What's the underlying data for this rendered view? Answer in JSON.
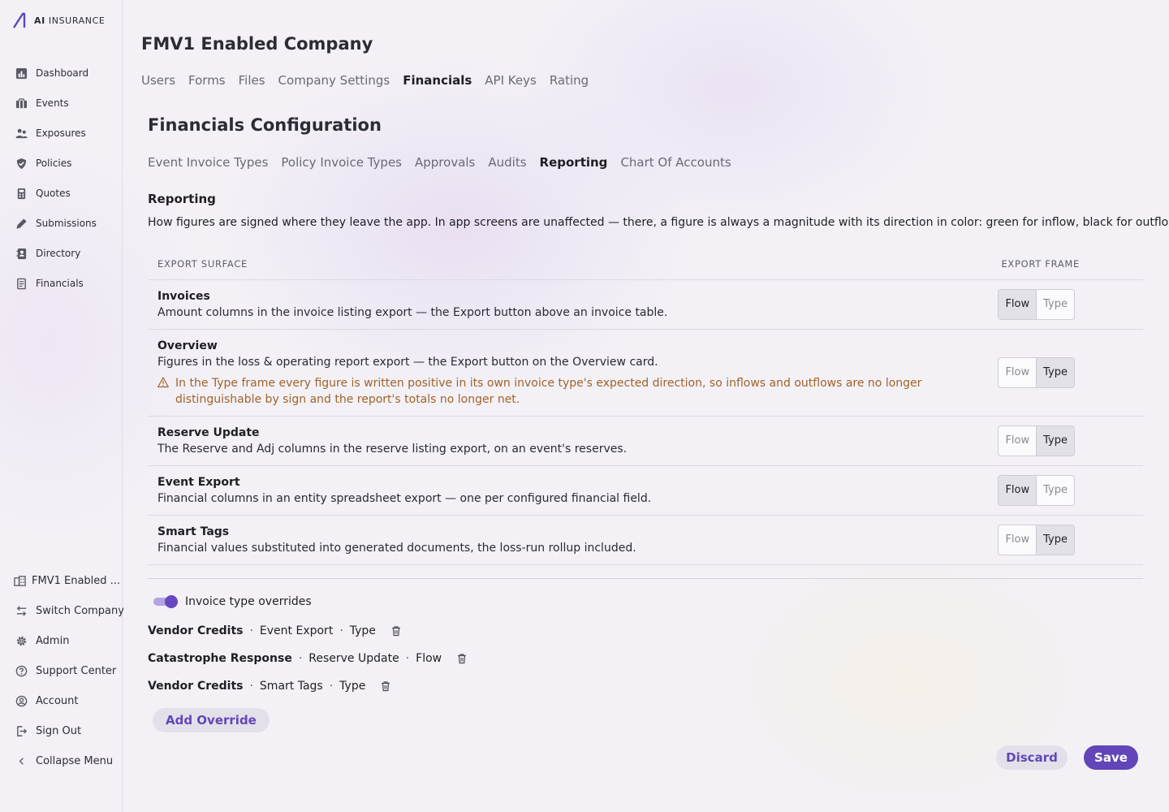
{
  "brand": {
    "name_bold": "AI",
    "name_rest": " INSURANCE",
    "accent": "#6245b8"
  },
  "sidebar": {
    "items": [
      {
        "label": "Dashboard",
        "icon": "bar-chart-icon"
      },
      {
        "label": "Events",
        "icon": "briefcase-icon"
      },
      {
        "label": "Exposures",
        "icon": "people-icon"
      },
      {
        "label": "Policies",
        "icon": "shield-icon"
      },
      {
        "label": "Quotes",
        "icon": "calculator-icon"
      },
      {
        "label": "Submissions",
        "icon": "pen-icon"
      },
      {
        "label": "Directory",
        "icon": "contact-book-icon"
      },
      {
        "label": "Financials",
        "icon": "receipt-icon"
      }
    ],
    "bottom": [
      {
        "label": "FMV1 Enabled ...",
        "icon": "building-icon"
      },
      {
        "label": "Switch Company",
        "icon": "switch-arrows-icon"
      },
      {
        "label": "Admin",
        "icon": "gear-icon"
      },
      {
        "label": "Support Center",
        "icon": "question-circle-icon"
      },
      {
        "label": "Account",
        "icon": "user-circle-icon"
      },
      {
        "label": "Sign Out",
        "icon": "sign-out-icon"
      },
      {
        "label": "Collapse Menu",
        "icon": "chevron-left-icon"
      }
    ]
  },
  "company": {
    "title": "FMV1 Enabled Company"
  },
  "top_tabs": [
    "Users",
    "Forms",
    "Files",
    "Company Settings",
    "Financials",
    "API Keys",
    "Rating"
  ],
  "top_tab_active": "Financials",
  "section": {
    "title": "Financials Configuration"
  },
  "sub_tabs": [
    "Event Invoice Types",
    "Policy Invoice Types",
    "Approvals",
    "Audits",
    "Reporting",
    "Chart Of Accounts"
  ],
  "sub_tab_active": "Reporting",
  "reporting": {
    "heading": "Reporting",
    "description": "How figures are signed where they leave the app. In app screens are unaffected — there, a figure is always a magnitude with its direction in color: green for inflow, black for outflow.",
    "col_surface": "EXPORT SURFACE",
    "col_frame": "EXPORT FRAME",
    "option_flow": "Flow",
    "option_type": "Type",
    "rows": [
      {
        "title": "Invoices",
        "desc": "Amount columns in the invoice listing export — the Export button above an invoice table.",
        "selected": "Flow"
      },
      {
        "title": "Overview",
        "desc": "Figures in the loss & operating report export — the Export button on the Overview card.",
        "warning": "In the Type frame every figure is written positive in its own invoice type's expected direction, so inflows and outflows are no longer distinguishable by sign and the report's totals no longer net.",
        "selected": "Type"
      },
      {
        "title": "Reserve Update",
        "desc": "The Reserve and Adj columns in the reserve listing export, on an event's reserves.",
        "selected": "Type"
      },
      {
        "title": "Event Export",
        "desc": "Financial columns in an entity spreadsheet export — one per configured financial field.",
        "selected": "Flow"
      },
      {
        "title": "Smart Tags",
        "desc": "Financial values substituted into generated documents, the loss-run rollup included.",
        "selected": "Type"
      }
    ]
  },
  "overrides": {
    "toggle_label": "Invoice type overrides",
    "enabled": true,
    "items": [
      {
        "invoice_type": "Vendor Credits",
        "surface": "Event Export",
        "frame": "Type"
      },
      {
        "invoice_type": "Catastrophe Response",
        "surface": "Reserve Update",
        "frame": "Flow"
      },
      {
        "invoice_type": "Vendor Credits",
        "surface": "Smart Tags",
        "frame": "Type"
      }
    ],
    "separator": "·",
    "add_label": "Add Override"
  },
  "actions": {
    "discard": "Discard",
    "save": "Save"
  },
  "colors": {
    "warning": "#a0622a",
    "primary": "#6245b8",
    "toggle_track": "#b5a2e0"
  }
}
